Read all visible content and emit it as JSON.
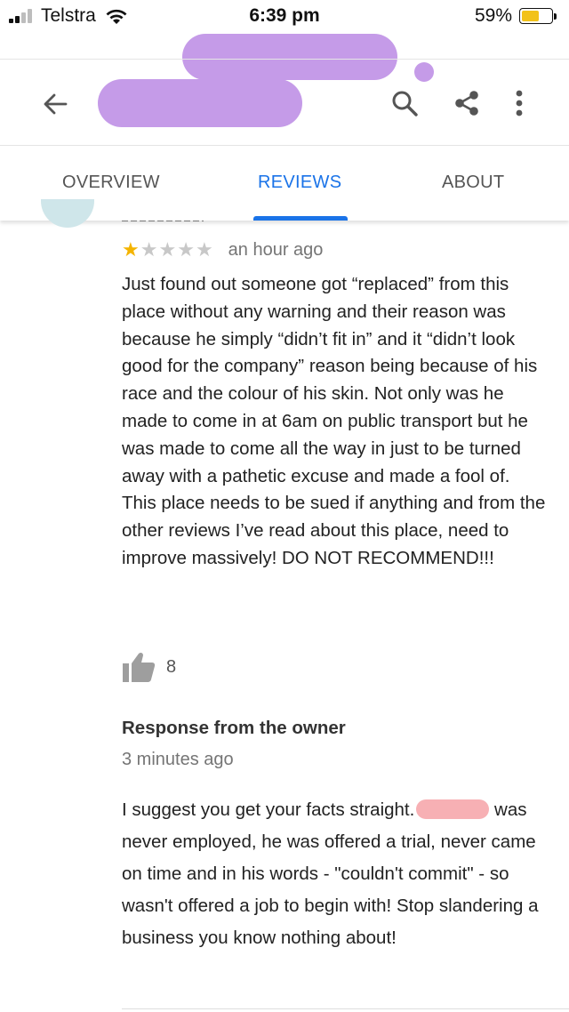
{
  "status_bar": {
    "carrier": "Telstra",
    "time": "6:39 pm",
    "battery_percent": "59%",
    "battery_level": 0.59
  },
  "toolbar": {
    "back_icon": "arrow-left-icon",
    "search_icon": "search-icon",
    "share_icon": "share-icon",
    "more_icon": "more-vert-icon"
  },
  "tabs": [
    {
      "label": "OVERVIEW",
      "active": false
    },
    {
      "label": "REVIEWS",
      "active": true
    },
    {
      "label": "ABOUT",
      "active": false
    }
  ],
  "review": {
    "rating": 1,
    "rating_max": 5,
    "time_ago": "an hour ago",
    "text": "Just found out someone got “replaced” from this place without any warning and their reason was because he simply “didn’t fit in” and it “didn’t look good for the company” reason being because of his race and the colour of his skin. Not only was he made to come in at 6am on public transport but he was made to come all the way in just to be turned away with a pathetic excuse and made a fool of. This place needs to be sued if anything and from the other reviews I’ve read about this place, need to improve massively! DO NOT RECOMMEND!!!",
    "likes": "8"
  },
  "owner_response": {
    "title": "Response from the owner",
    "time_ago": "3 minutes ago",
    "text_before_redaction": "I suggest you get your facts straight.",
    "text_after_redaction": "was never employed, he was offered a trial, never came on time and in his words - \"couldn't commit\" - so wasn't offered a job to begin with! Stop slandering a business you know nothing about!"
  },
  "colors": {
    "accent": "#1a73e8",
    "star_on": "#f4b400",
    "star_off": "#c8c8c8",
    "redaction_purple": "#c59be8",
    "redaction_pink": "#f7b0b4",
    "battery": "#f2c21a"
  }
}
